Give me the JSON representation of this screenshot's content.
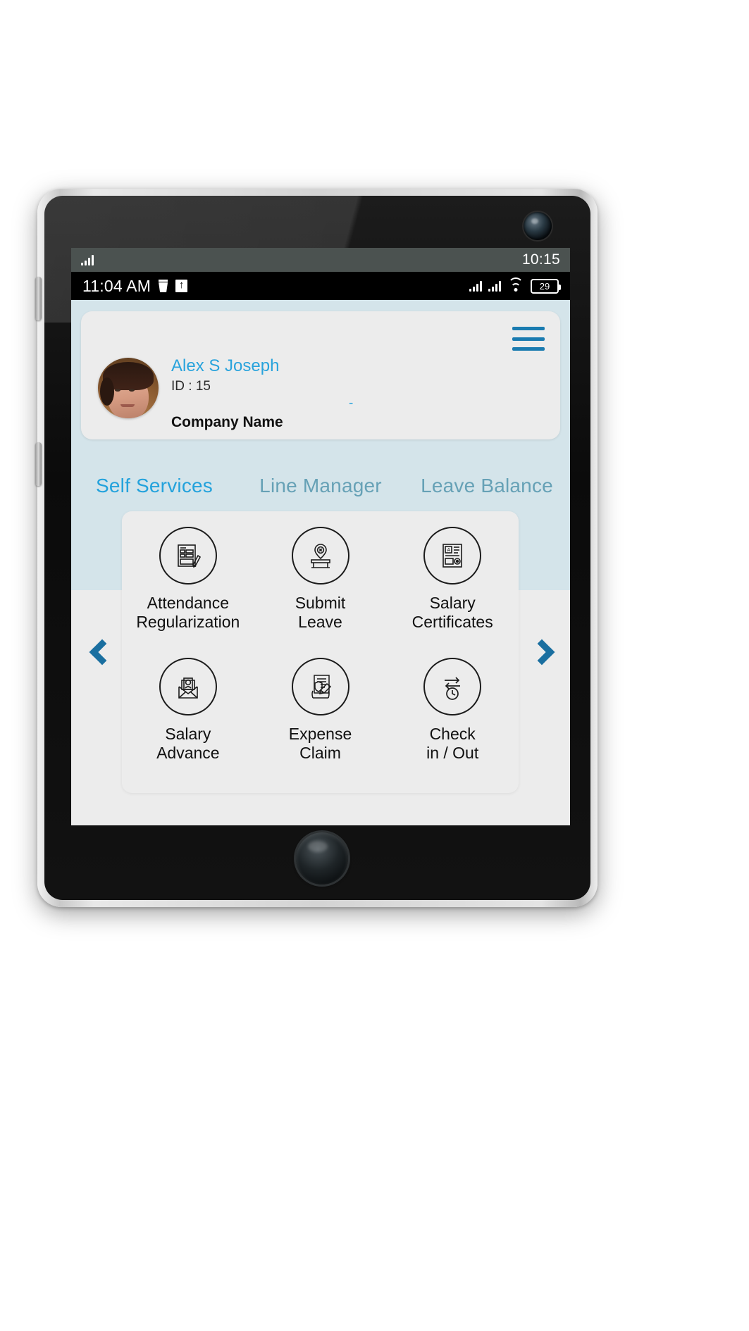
{
  "device": {
    "status_strip": {
      "clock": "10:15",
      "signal_icon": "signal-bars-icon"
    }
  },
  "status_bar": {
    "time": "11:04 AM",
    "left_icons": [
      "trash-icon",
      "upload-icon"
    ],
    "right_icons": [
      "signal-bars-icon",
      "signal-bars-icon",
      "wifi-icon"
    ],
    "battery_level": "29"
  },
  "profile": {
    "menu_icon": "hamburger-menu-icon",
    "avatar": "user-avatar",
    "name": "Alex S Joseph",
    "id": "ID : 15",
    "company": "Company Name",
    "dash": "-"
  },
  "tabs": [
    {
      "label": "Self Services",
      "active": true
    },
    {
      "label": "Line Manager",
      "active": false
    },
    {
      "label": "Leave Balance",
      "active": false
    }
  ],
  "services": {
    "row1": [
      {
        "label": "Attendance\nRegularization",
        "icon": "document-pen-icon"
      },
      {
        "label": "Submit\nLeave",
        "icon": "desk-absent-icon"
      },
      {
        "label": "Salary\nCertificates",
        "icon": "certificate-icon"
      }
    ],
    "row2": [
      {
        "label": "Salary\nAdvance",
        "icon": "envelope-money-icon"
      },
      {
        "label": "Expense\nClaim",
        "icon": "claim-form-icon"
      },
      {
        "label": "Check\nin / Out",
        "icon": "check-in-out-icon"
      }
    ]
  },
  "carousel": {
    "prev_label": "prev-page-arrow",
    "next_label": "next-page-arrow"
  },
  "colors": {
    "accent_blue": "#23a2dc",
    "header_band": "#d4e4ea",
    "panel_bg": "#ececec",
    "arrow_blue": "#1a6fa0"
  }
}
